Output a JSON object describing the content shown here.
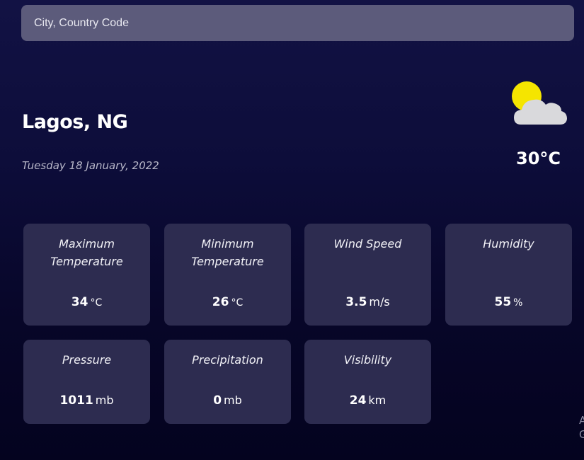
{
  "search": {
    "placeholder": "City, Country Code",
    "value": ""
  },
  "location": {
    "city": "Lagos, NG",
    "date": "Tuesday 18 January, 2022"
  },
  "current": {
    "icon": "partly-cloudy-icon",
    "temperature": "30°C"
  },
  "metrics": [
    {
      "label": "Maximum Temperature",
      "value": "34",
      "unit": "°C"
    },
    {
      "label": "Minimum Temperature",
      "value": "26",
      "unit": "°C"
    },
    {
      "label": "Wind Speed",
      "value": "3.5",
      "unit": "m/s"
    },
    {
      "label": "Humidity",
      "value": "55",
      "unit": "%"
    },
    {
      "label": "Pressure",
      "value": "1011",
      "unit": "mb"
    },
    {
      "label": "Precipitation",
      "value": "0",
      "unit": "mb"
    },
    {
      "label": "Visibility",
      "value": "24",
      "unit": "km"
    }
  ],
  "corner": {
    "line1": "A",
    "line2": "G"
  },
  "colors": {
    "card_background": "#2d2c50",
    "search_background": "#5c5b7b",
    "sun": "#f5e500",
    "cloud": "#d9d9dc"
  }
}
